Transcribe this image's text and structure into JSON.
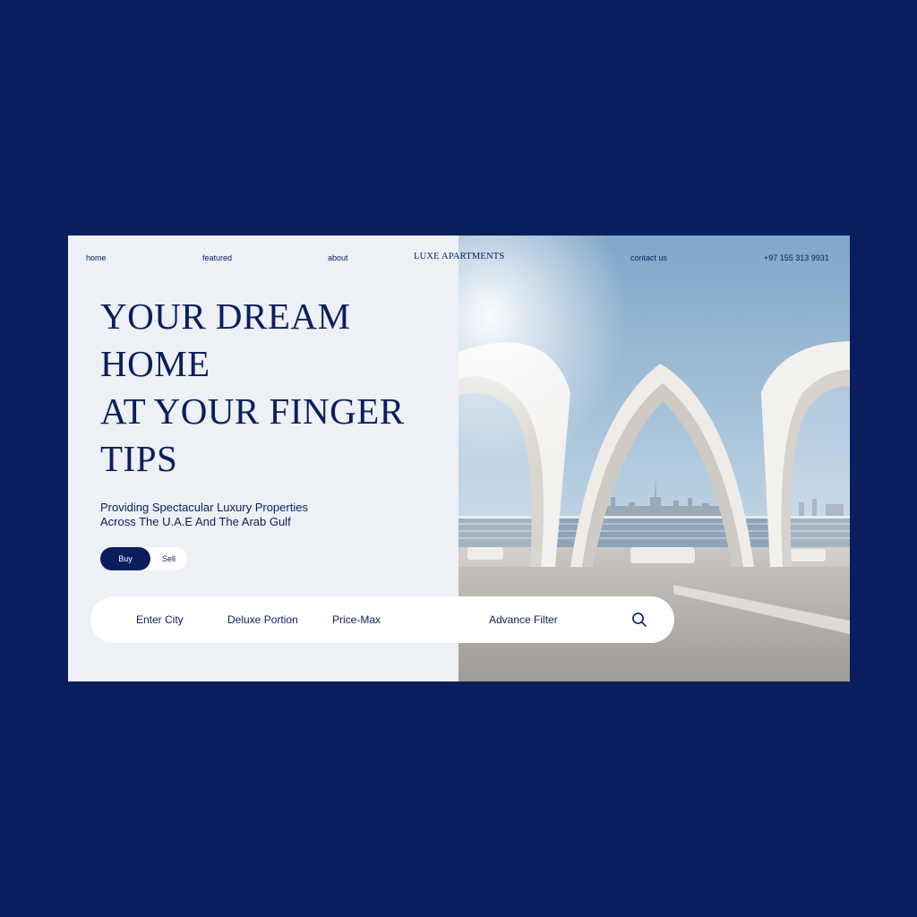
{
  "nav": {
    "home": "home",
    "featured": "featured",
    "about": "about",
    "brand": "LUXE APARTMENTS",
    "contact": "contact us",
    "phone": "+97 155 313 9931"
  },
  "hero": {
    "lines": [
      "YOUR DREAM",
      "HOME",
      "AT YOUR FINGER",
      "TIPS"
    ]
  },
  "subtitle": {
    "lines": [
      "Providing Spectacular Luxury Properties",
      "Across The U.A.E And The Arab Gulf"
    ]
  },
  "toggle": {
    "buy": "Buy",
    "sell": "Sell",
    "selected": "Buy"
  },
  "search": {
    "city": "Enter City",
    "portion": "Deluxe Portion",
    "price": "Price-Max",
    "filter": "Advance Filter",
    "icon": "search-icon"
  },
  "colors": {
    "background": "#0a1e5e",
    "panel": "#edf0f5",
    "accent": "#0a1e5e",
    "white": "#ffffff"
  }
}
